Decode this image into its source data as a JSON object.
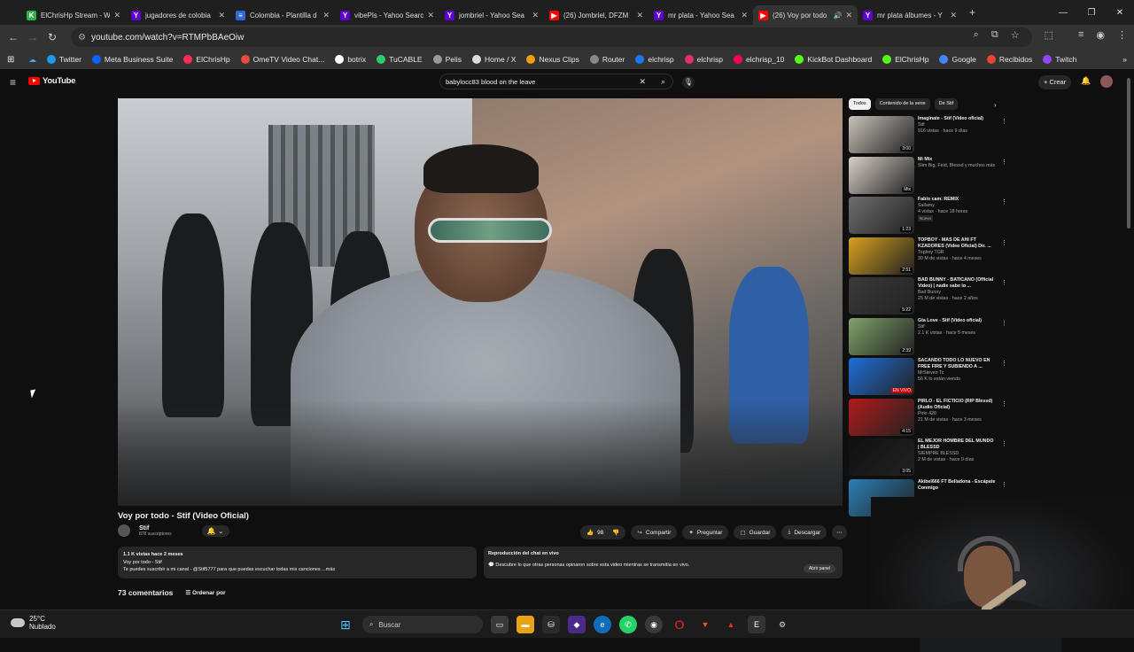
{
  "browser": {
    "tabs": [
      {
        "title": "ElChrisHp Stream - W",
        "icon_color": "#2bb24c",
        "glyph": "K"
      },
      {
        "title": "jugadores de colobia",
        "icon_color": "#6001d2",
        "glyph": "Y"
      },
      {
        "title": "Colombia - Plantilla d",
        "icon_color": "#3367d6",
        "glyph": "≡"
      },
      {
        "title": "vibePls - Yahoo Searc",
        "icon_color": "#6001d2",
        "glyph": "Y"
      },
      {
        "title": "jombriel - Yahoo Sea",
        "icon_color": "#6001d2",
        "glyph": "Y"
      },
      {
        "title": "(26) Jombriel, DFZM",
        "icon_color": "#ff0000",
        "glyph": "▶"
      },
      {
        "title": "mr plata - Yahoo Sea",
        "icon_color": "#6001d2",
        "glyph": "Y"
      },
      {
        "title": "(26) Voy por todo",
        "icon_color": "#ff0000",
        "glyph": "▶",
        "active": true
      },
      {
        "title": "mr plata álbumes - Y",
        "icon_color": "#6001d2",
        "glyph": "Y"
      }
    ],
    "url": "youtube.com/watch?v=RTMPbBAeOiw",
    "bookmarks": [
      {
        "label": "Twitter",
        "color": "#1d9bf0"
      },
      {
        "label": "Meta Business Suite",
        "color": "#0866ff"
      },
      {
        "label": "ElChrisHp",
        "color": "#fe2c55"
      },
      {
        "label": "OmeTV Video Chat...",
        "color": "#e74c3c"
      },
      {
        "label": "botrix",
        "color": "#ffffff"
      },
      {
        "label": "TuCABLE",
        "color": "#2ecc71"
      },
      {
        "label": "Pelis",
        "color": "#999999"
      },
      {
        "label": "Home / X",
        "color": "#dddddd"
      },
      {
        "label": "Nexus Clips",
        "color": "#f39c12"
      },
      {
        "label": "Router",
        "color": "#888888"
      },
      {
        "label": "elchrisp",
        "color": "#1877f2"
      },
      {
        "label": "elchrisp",
        "color": "#e1306c"
      },
      {
        "label": "elchrisp_10",
        "color": "#ff0050"
      },
      {
        "label": "KickBot Dashboard",
        "color": "#53fc18"
      },
      {
        "label": "ElChrisHp",
        "color": "#53fc18"
      },
      {
        "label": "Google",
        "color": "#4285f4"
      },
      {
        "label": "Recibidos",
        "color": "#ea4335"
      },
      {
        "label": "Twitch",
        "color": "#9146ff"
      }
    ]
  },
  "youtube": {
    "logo": "YouTube",
    "search_value": "babylocc83 blood on the leave",
    "create_label": "Crear",
    "video": {
      "title": "Voy por todo - Stif (Video Oficial)",
      "channel": "Stif",
      "subscribers": "878 suscriptores",
      "likes": "98",
      "share": "Compartir",
      "ask": "Preguntar",
      "save": "Guardar",
      "download": "Descargar",
      "views_date": "1.1 K vistas  hace 2 meses",
      "desc_line1": "Voy por todo - Stif",
      "desc_line2": "Te puedes suscribir a mi canal - @Stif5777 para que puedas escuchar  todas mis canciones   ...más"
    },
    "chat": {
      "title": "Reproducción del chat en vivo",
      "text": "Descubre lo que otras personas opinaron sobre esta video mientras se transmitía en vivo.",
      "open_label": "Abrir panel"
    },
    "comments": {
      "count": "73 comentarios",
      "sort": "Ordenar por"
    },
    "chips": [
      "Todos",
      "Contenido de la serie",
      "De Stif"
    ],
    "recommendations": [
      {
        "title": "Imaginate - Stif (Video oficial)",
        "channel": "Stif",
        "meta": "916 vistas · hace 9 días",
        "duration": "3:00",
        "thumb": "#c9c3b8"
      },
      {
        "title": "Mi Mix",
        "channel": "Slim Big, Feid, Blessd y muchos más",
        "meta": "",
        "duration": "Mix",
        "thumb": "#d9cfc6"
      },
      {
        "title": "Fabio cam: REMIX",
        "channel": "Sallamy",
        "meta": "4 vistas · hace 18 horas",
        "badge": "Nuevo",
        "duration": "1:23",
        "thumb": "#6e6e6e"
      },
      {
        "title": "TOPBOY - MÁS DE AHÍ FT KZADORES (Video Oficial) Dir. ...",
        "channel": "Topboy TGR",
        "meta": "30 M de vistas · hace 4 meses",
        "duration": "2:51",
        "thumb": "#d8a020"
      },
      {
        "title": "BAD BUNNY - BATICANO (Official Video) | nadie sabe lo ...",
        "channel": "Bad Bunny",
        "meta": "25 M de vistas · hace 2 años",
        "duration": "5:22",
        "thumb": "#3a3a3a"
      },
      {
        "title": "Gta Love - Stif (Video oficial)",
        "channel": "Stif",
        "meta": "2.1 K vistas · hace 5 meses",
        "duration": "2:39",
        "thumb": "#7fa36a"
      },
      {
        "title": "SACANDO TODO LO NUEVO EN FREE FIRE Y SUBIENDO A ...",
        "channel": "MrSteven Tc",
        "meta": "56 K lo están viendo",
        "duration": "EN VIVO",
        "thumb": "#1e6fd9"
      },
      {
        "title": "PIRLO - EL FICTICIO (RIP Blessd) (Audio Oficial)",
        "channel": "Pirlo 420",
        "meta": "21 M de vistas · hace 3 meses",
        "duration": "4:15",
        "thumb": "#b11a1a"
      },
      {
        "title": "EL MEJOR HOMBRE DEL MUNDO | BLESSD",
        "channel": "SIEMPRE BLESSD",
        "meta": "2 M de vistas · hace 9 días",
        "duration": "3:05",
        "thumb": "#101010"
      },
      {
        "title": "Akibel666 FT Belladona - Escápate Conmigo",
        "channel": "",
        "meta": "",
        "duration": "",
        "thumb": "#2b7fb8"
      }
    ]
  },
  "taskbar": {
    "temperature": "25°C",
    "condition": "Nublado",
    "search_placeholder": "Buscar"
  }
}
